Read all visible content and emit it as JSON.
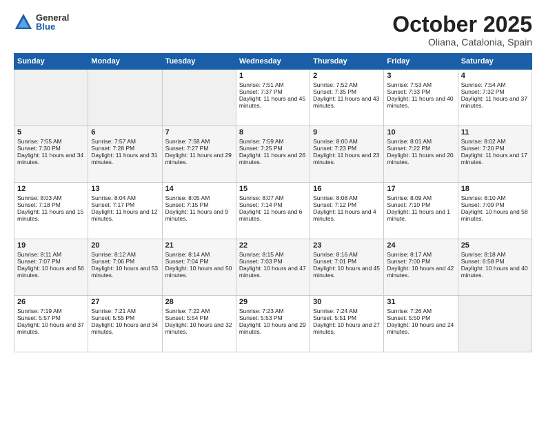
{
  "logo": {
    "general": "General",
    "blue": "Blue"
  },
  "header": {
    "month": "October 2025",
    "location": "Oliana, Catalonia, Spain"
  },
  "weekdays": [
    "Sunday",
    "Monday",
    "Tuesday",
    "Wednesday",
    "Thursday",
    "Friday",
    "Saturday"
  ],
  "weeks": [
    [
      {
        "day": "",
        "empty": true
      },
      {
        "day": "",
        "empty": true
      },
      {
        "day": "",
        "empty": true
      },
      {
        "day": "1",
        "sunrise": "7:51 AM",
        "sunset": "7:37 PM",
        "daylight": "11 hours and 45 minutes."
      },
      {
        "day": "2",
        "sunrise": "7:52 AM",
        "sunset": "7:35 PM",
        "daylight": "11 hours and 43 minutes."
      },
      {
        "day": "3",
        "sunrise": "7:53 AM",
        "sunset": "7:33 PM",
        "daylight": "11 hours and 40 minutes."
      },
      {
        "day": "4",
        "sunrise": "7:54 AM",
        "sunset": "7:32 PM",
        "daylight": "11 hours and 37 minutes."
      }
    ],
    [
      {
        "day": "5",
        "sunrise": "7:55 AM",
        "sunset": "7:30 PM",
        "daylight": "11 hours and 34 minutes."
      },
      {
        "day": "6",
        "sunrise": "7:57 AM",
        "sunset": "7:28 PM",
        "daylight": "11 hours and 31 minutes."
      },
      {
        "day": "7",
        "sunrise": "7:58 AM",
        "sunset": "7:27 PM",
        "daylight": "11 hours and 29 minutes."
      },
      {
        "day": "8",
        "sunrise": "7:59 AM",
        "sunset": "7:25 PM",
        "daylight": "11 hours and 26 minutes."
      },
      {
        "day": "9",
        "sunrise": "8:00 AM",
        "sunset": "7:23 PM",
        "daylight": "11 hours and 23 minutes."
      },
      {
        "day": "10",
        "sunrise": "8:01 AM",
        "sunset": "7:22 PM",
        "daylight": "11 hours and 20 minutes."
      },
      {
        "day": "11",
        "sunrise": "8:02 AM",
        "sunset": "7:20 PM",
        "daylight": "11 hours and 17 minutes."
      }
    ],
    [
      {
        "day": "12",
        "sunrise": "8:03 AM",
        "sunset": "7:18 PM",
        "daylight": "11 hours and 15 minutes."
      },
      {
        "day": "13",
        "sunrise": "8:04 AM",
        "sunset": "7:17 PM",
        "daylight": "11 hours and 12 minutes."
      },
      {
        "day": "14",
        "sunrise": "8:05 AM",
        "sunset": "7:15 PM",
        "daylight": "11 hours and 9 minutes."
      },
      {
        "day": "15",
        "sunrise": "8:07 AM",
        "sunset": "7:14 PM",
        "daylight": "11 hours and 6 minutes."
      },
      {
        "day": "16",
        "sunrise": "8:08 AM",
        "sunset": "7:12 PM",
        "daylight": "11 hours and 4 minutes."
      },
      {
        "day": "17",
        "sunrise": "8:09 AM",
        "sunset": "7:10 PM",
        "daylight": "11 hours and 1 minute."
      },
      {
        "day": "18",
        "sunrise": "8:10 AM",
        "sunset": "7:09 PM",
        "daylight": "10 hours and 58 minutes."
      }
    ],
    [
      {
        "day": "19",
        "sunrise": "8:11 AM",
        "sunset": "7:07 PM",
        "daylight": "10 hours and 56 minutes."
      },
      {
        "day": "20",
        "sunrise": "8:12 AM",
        "sunset": "7:06 PM",
        "daylight": "10 hours and 53 minutes."
      },
      {
        "day": "21",
        "sunrise": "8:14 AM",
        "sunset": "7:04 PM",
        "daylight": "10 hours and 50 minutes."
      },
      {
        "day": "22",
        "sunrise": "8:15 AM",
        "sunset": "7:03 PM",
        "daylight": "10 hours and 47 minutes."
      },
      {
        "day": "23",
        "sunrise": "8:16 AM",
        "sunset": "7:01 PM",
        "daylight": "10 hours and 45 minutes."
      },
      {
        "day": "24",
        "sunrise": "8:17 AM",
        "sunset": "7:00 PM",
        "daylight": "10 hours and 42 minutes."
      },
      {
        "day": "25",
        "sunrise": "8:18 AM",
        "sunset": "6:58 PM",
        "daylight": "10 hours and 40 minutes."
      }
    ],
    [
      {
        "day": "26",
        "sunrise": "7:19 AM",
        "sunset": "5:57 PM",
        "daylight": "10 hours and 37 minutes."
      },
      {
        "day": "27",
        "sunrise": "7:21 AM",
        "sunset": "5:55 PM",
        "daylight": "10 hours and 34 minutes."
      },
      {
        "day": "28",
        "sunrise": "7:22 AM",
        "sunset": "5:54 PM",
        "daylight": "10 hours and 32 minutes."
      },
      {
        "day": "29",
        "sunrise": "7:23 AM",
        "sunset": "5:53 PM",
        "daylight": "10 hours and 29 minutes."
      },
      {
        "day": "30",
        "sunrise": "7:24 AM",
        "sunset": "5:51 PM",
        "daylight": "10 hours and 27 minutes."
      },
      {
        "day": "31",
        "sunrise": "7:26 AM",
        "sunset": "5:50 PM",
        "daylight": "10 hours and 24 minutes."
      },
      {
        "day": "",
        "empty": true
      }
    ]
  ]
}
